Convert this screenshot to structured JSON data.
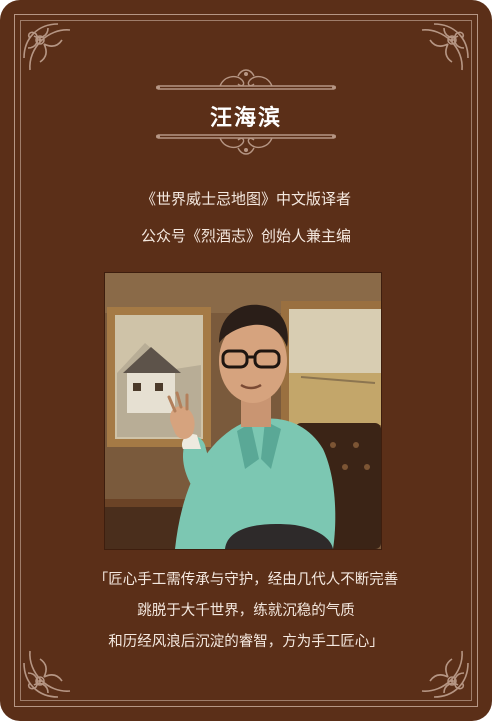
{
  "profile": {
    "name": "汪海滨",
    "titles": [
      "《世界威士忌地图》中文版译者",
      "公众号《烈酒志》创始人兼主编"
    ],
    "photo_icon": "portrait-photo"
  },
  "quote": {
    "lines": [
      "「匠心手工需传承与守护，经由几代人不断完善",
      "跳脱于大千世界，练就沉稳的气质",
      "和历经风浪后沉淀的睿智，方为手工匠心」"
    ]
  },
  "colors": {
    "background": "#5b2f18",
    "frame": "#b69684",
    "text": "#f4e8df",
    "name_text": "#ffffff"
  }
}
